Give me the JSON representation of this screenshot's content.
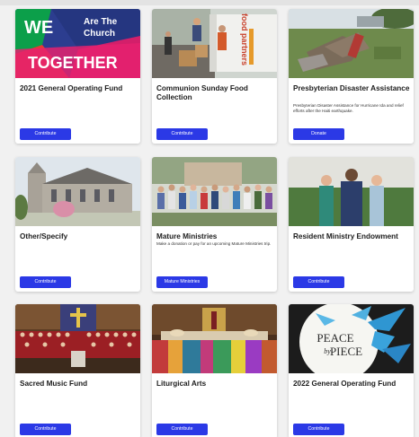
{
  "cards": [
    {
      "title": "2021 General Operating Fund",
      "description": "",
      "button_label": "Contribute",
      "image": {
        "lines": [
          "WE",
          "Are The",
          "Church",
          "TOGETHER"
        ]
      }
    },
    {
      "title": "Communion Sunday Food Collection",
      "description": "",
      "button_label": "Contribute",
      "image": {
        "truck_text": "food partners"
      }
    },
    {
      "title": "Presbyterian Disaster Assistance",
      "description": "Presbyterian Disaster Assistance for Hurricane Ida and relief efforts after the Haiti earthquake.",
      "button_label": "Donate"
    },
    {
      "title": "Other/Specify",
      "description": "",
      "button_label": "Contribute"
    },
    {
      "title": "Mature Ministries",
      "description": "Make a donation or pay for an upcoming Mature Ministries trip.",
      "button_label": "Mature Ministries"
    },
    {
      "title": "Resident Ministry Endowment",
      "description": "",
      "button_label": "Contribute"
    },
    {
      "title": "Sacred Music Fund",
      "description": "",
      "button_label": "Contribute"
    },
    {
      "title": "Liturgical Arts",
      "description": "",
      "button_label": "Contribute"
    },
    {
      "title": "2022 General Operating Fund",
      "description": "",
      "button_label": "Contribute",
      "image": {
        "lines": [
          "PEACE",
          "by",
          "PIECE"
        ]
      }
    }
  ],
  "colors": {
    "button": "#2b39e6",
    "card": "#ffffff",
    "background": "#f1f1f1"
  }
}
